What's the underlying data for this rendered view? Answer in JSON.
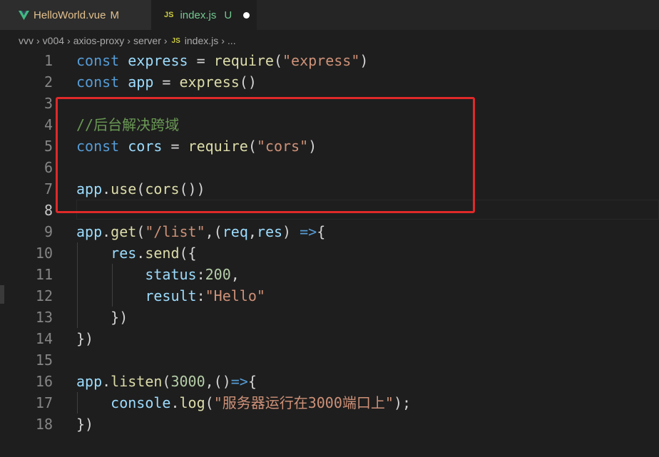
{
  "tabs": [
    {
      "label": "HelloWorld.vue",
      "status": "M",
      "icon": "vue-icon"
    },
    {
      "label": "index.js",
      "status": "U",
      "icon": "js-icon",
      "icon_text": "JS",
      "dirty": true
    }
  ],
  "breadcrumb": {
    "items": [
      "vvv",
      "v004",
      "axios-proxy",
      "server"
    ],
    "file_icon": "JS",
    "file": "index.js",
    "trailing": "..."
  },
  "editor": {
    "active_line": 8,
    "line_numbers": [
      "1",
      "2",
      "3",
      "4",
      "5",
      "6",
      "7",
      "8",
      "9",
      "10",
      "11",
      "12",
      "13",
      "14",
      "15",
      "16",
      "17",
      "18"
    ],
    "lines": [
      {
        "n": "1",
        "tokens": [
          [
            "kw",
            "const "
          ],
          [
            "var",
            "express"
          ],
          [
            "op",
            " = "
          ],
          [
            "fn",
            "require"
          ],
          [
            "op",
            "("
          ],
          [
            "str",
            "\"express\""
          ],
          [
            "op",
            ")"
          ]
        ]
      },
      {
        "n": "2",
        "tokens": [
          [
            "kw",
            "const "
          ],
          [
            "var",
            "app"
          ],
          [
            "op",
            " = "
          ],
          [
            "fn",
            "express"
          ],
          [
            "op",
            "()"
          ]
        ]
      },
      {
        "n": "3",
        "tokens": []
      },
      {
        "n": "4",
        "tokens": [
          [
            "cmt",
            "//后台解决跨域"
          ]
        ]
      },
      {
        "n": "5",
        "tokens": [
          [
            "kw",
            "const "
          ],
          [
            "var",
            "cors"
          ],
          [
            "op",
            " = "
          ],
          [
            "fn",
            "require"
          ],
          [
            "op",
            "("
          ],
          [
            "str",
            "\"cors\""
          ],
          [
            "op",
            ")"
          ]
        ]
      },
      {
        "n": "6",
        "tokens": []
      },
      {
        "n": "7",
        "tokens": [
          [
            "var",
            "app"
          ],
          [
            "op",
            "."
          ],
          [
            "fn",
            "use"
          ],
          [
            "op",
            "("
          ],
          [
            "fn",
            "cors"
          ],
          [
            "op",
            "())"
          ]
        ]
      },
      {
        "n": "8",
        "tokens": []
      },
      {
        "n": "9",
        "tokens": [
          [
            "var",
            "app"
          ],
          [
            "op",
            "."
          ],
          [
            "fn",
            "get"
          ],
          [
            "op",
            "("
          ],
          [
            "str",
            "\"/list\""
          ],
          [
            "op",
            ",("
          ],
          [
            "var",
            "req"
          ],
          [
            "op",
            ","
          ],
          [
            "var",
            "res"
          ],
          [
            "op",
            ") "
          ],
          [
            "kw",
            "=>"
          ],
          [
            "op",
            "{"
          ]
        ]
      },
      {
        "n": "10",
        "tokens": [
          [
            "op",
            "    "
          ],
          [
            "var",
            "res"
          ],
          [
            "op",
            "."
          ],
          [
            "fn",
            "send"
          ],
          [
            "op",
            "({"
          ]
        ]
      },
      {
        "n": "11",
        "tokens": [
          [
            "op",
            "        "
          ],
          [
            "var",
            "status"
          ],
          [
            "op",
            ":"
          ],
          [
            "num",
            "200"
          ],
          [
            "op",
            ","
          ]
        ]
      },
      {
        "n": "12",
        "tokens": [
          [
            "op",
            "        "
          ],
          [
            "var",
            "result"
          ],
          [
            "op",
            ":"
          ],
          [
            "str",
            "\"Hello\""
          ]
        ]
      },
      {
        "n": "13",
        "tokens": [
          [
            "op",
            "    })"
          ]
        ]
      },
      {
        "n": "14",
        "tokens": [
          [
            "op",
            "})"
          ]
        ]
      },
      {
        "n": "15",
        "tokens": []
      },
      {
        "n": "16",
        "tokens": [
          [
            "var",
            "app"
          ],
          [
            "op",
            "."
          ],
          [
            "fn",
            "listen"
          ],
          [
            "op",
            "("
          ],
          [
            "num",
            "3000"
          ],
          [
            "op",
            ",()"
          ],
          [
            "kw",
            "=>"
          ],
          [
            "op",
            "{"
          ]
        ]
      },
      {
        "n": "17",
        "tokens": [
          [
            "op",
            "    "
          ],
          [
            "var",
            "console"
          ],
          [
            "op",
            "."
          ],
          [
            "fn",
            "log"
          ],
          [
            "op",
            "("
          ],
          [
            "str",
            "\"服务器运行在3000端口上\""
          ],
          [
            "op",
            ");"
          ]
        ]
      },
      {
        "n": "18",
        "tokens": [
          [
            "op",
            "})"
          ]
        ]
      }
    ]
  },
  "colors": {
    "keyword": "#569cd6",
    "variable": "#9cdcfe",
    "function": "#dcdcaa",
    "string": "#ce9178",
    "number": "#b5cea8",
    "comment": "#6a9955",
    "highlight_box": "#e0292a"
  }
}
